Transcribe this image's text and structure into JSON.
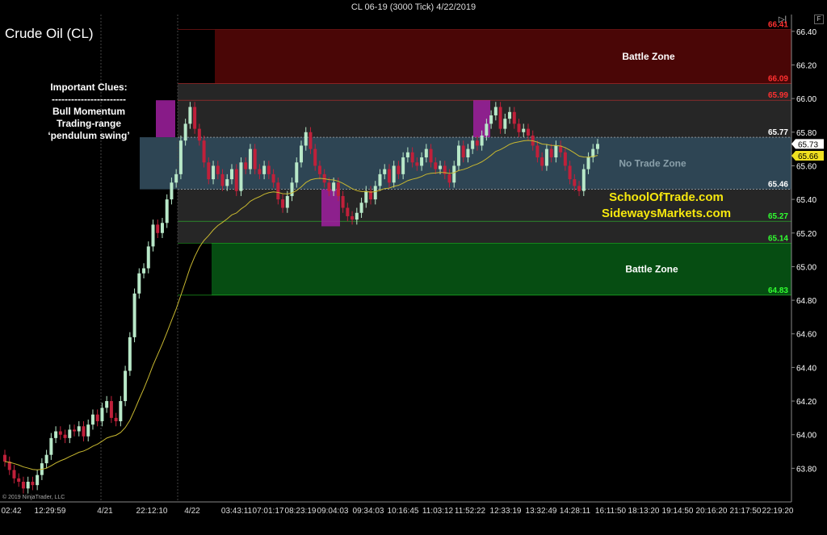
{
  "window": {
    "title": "CL 06-19 (3000 Tick)  4/22/2019",
    "instrument": "Crude Oil (CL)",
    "copyright": "© 2019 NinjaTrader, LLC",
    "panel_button": "F"
  },
  "icons": {
    "collapse": "collapse-right-icon",
    "panel": "f-panel-icon"
  },
  "colors": {
    "background": "#000000",
    "up_candle": "#b8e8c8",
    "down_candle": "#c0203a",
    "ma": "#c8b830",
    "upper_zone": "#4a0606",
    "lower_zone": "#064d12",
    "mid_band": "#262626",
    "no_trade": "#2e4554",
    "highlight": "#a020a0",
    "watermark": "#f6e70e"
  },
  "chart_data": {
    "type": "candlestick",
    "title": "CL 06-19 (3000 Tick)  4/22/2019",
    "instrument": "Crude Oil (CL)",
    "ylim": [
      63.6,
      66.5
    ],
    "y_ticks": [
      "66.40",
      "66.20",
      "66.00",
      "65.80",
      "65.60",
      "65.40",
      "65.20",
      "65.00",
      "64.80",
      "64.60",
      "64.40",
      "64.20",
      "64.00",
      "63.80"
    ],
    "x_ticks": [
      "02:42",
      "12:29:59",
      "4/21",
      "22:12:10",
      "4/22",
      "03:43:11",
      "07:01:17",
      "08:23:19",
      "09:04:03",
      "09:34:03",
      "10:16:45",
      "11:03:12",
      "11:52:22",
      "12:33:19",
      "13:32:49",
      "14:28:11",
      "16:11:50",
      "18:13:20",
      "19:14:50",
      "20:16:20",
      "21:17:50",
      "22:19:20"
    ],
    "last_price": "65.73",
    "ma_value": "65.66",
    "levels": [
      {
        "label": "66.41",
        "value": 66.41,
        "color": "#ff3030"
      },
      {
        "label": "66.09",
        "value": 66.09,
        "color": "#ff3030"
      },
      {
        "label": "65.99",
        "value": 65.99,
        "color": "#ff3030"
      },
      {
        "label": "65.77",
        "value": 65.77,
        "color": "#ffffff"
      },
      {
        "label": "65.46",
        "value": 65.46,
        "color": "#ffffff"
      },
      {
        "label": "65.27",
        "value": 65.27,
        "color": "#30ff30"
      },
      {
        "label": "65.14",
        "value": 65.14,
        "color": "#30ff30"
      },
      {
        "label": "64.83",
        "value": 64.83,
        "color": "#30ff30"
      }
    ],
    "zones": [
      {
        "name": "upper-battle-zone",
        "label": "Battle Zone",
        "from": 66.09,
        "to": 66.41
      },
      {
        "name": "lower-battle-zone",
        "label": "Battle Zone",
        "from": 64.83,
        "to": 65.14
      },
      {
        "name": "no-trade-zone",
        "label": "No Trade Zone",
        "from": 65.46,
        "to": 65.77
      }
    ],
    "annotations": {
      "clues": [
        "Important Clues:",
        "-----------------------",
        "Bull Momentum",
        "Trading-range",
        "‘pendulum swing’"
      ],
      "watermark_1": "SchoolOfTrade.com",
      "watermark_2": "SidewaysMarkets.com"
    },
    "closes": [
      63.84,
      63.79,
      63.74,
      63.72,
      63.68,
      63.72,
      63.7,
      63.76,
      63.83,
      63.88,
      63.98,
      64.02,
      64.0,
      63.98,
      64.03,
      64.02,
      64.05,
      63.99,
      64.06,
      64.12,
      64.08,
      64.16,
      64.2,
      64.1,
      64.08,
      64.2,
      64.38,
      64.58,
      64.84,
      64.96,
      64.99,
      65.12,
      65.25,
      65.2,
      65.26,
      65.4,
      65.5,
      65.55,
      65.75,
      65.85,
      65.95,
      65.82,
      65.75,
      65.62,
      65.52,
      65.6,
      65.55,
      65.48,
      65.52,
      65.58,
      65.45,
      65.62,
      65.58,
      65.7,
      65.58,
      65.55,
      65.6,
      65.55,
      65.5,
      65.4,
      65.35,
      65.42,
      65.5,
      65.62,
      65.72,
      65.8,
      65.7,
      65.6,
      65.55,
      65.5,
      65.45,
      65.5,
      65.42,
      65.35,
      65.3,
      65.28,
      65.32,
      65.38,
      65.45,
      65.4,
      65.48,
      65.55,
      65.58,
      65.5,
      65.6,
      65.55,
      65.65,
      65.68,
      65.62,
      65.6,
      65.65,
      65.7,
      65.62,
      65.58,
      65.6,
      65.55,
      65.5,
      65.6,
      65.72,
      65.65,
      65.7,
      65.75,
      65.72,
      65.78,
      65.85,
      65.9,
      65.95,
      65.82,
      65.88,
      65.92,
      65.85,
      65.8,
      65.82,
      65.78,
      65.72,
      65.65,
      65.6,
      65.7,
      65.65,
      65.72,
      65.68,
      65.6,
      65.52,
      65.48,
      65.45,
      65.58,
      65.65,
      65.7,
      65.73
    ]
  }
}
